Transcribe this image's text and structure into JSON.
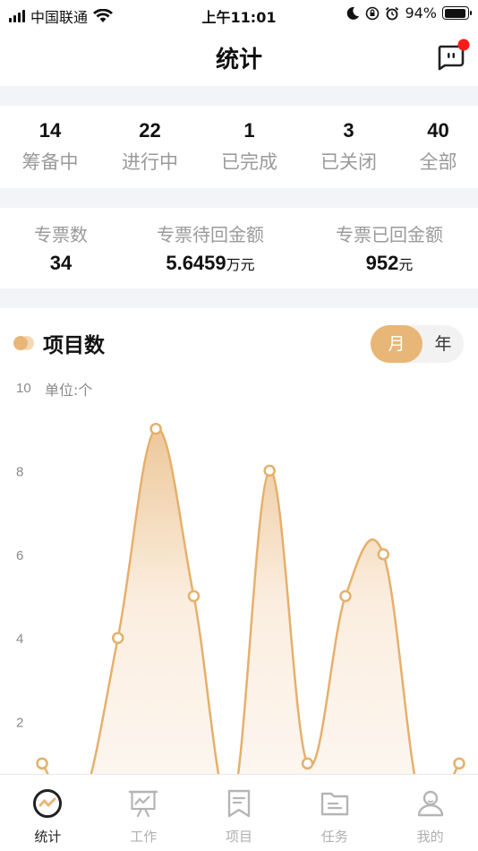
{
  "status_bar": {
    "carrier": "中国联通",
    "time": "上午11:01",
    "battery": "94%",
    "battery_level": 0.94
  },
  "nav": {
    "title": "统计",
    "message_icon": "chat-bubble-icon",
    "has_notification": true
  },
  "project_stats": [
    {
      "count": "14",
      "label": "筹备中"
    },
    {
      "count": "22",
      "label": "进行中"
    },
    {
      "count": "1",
      "label": "已完成"
    },
    {
      "count": "3",
      "label": "已关闭"
    },
    {
      "count": "40",
      "label": "全部"
    }
  ],
  "tickets": {
    "count_label": "专票数",
    "count_value": "34",
    "pending_label": "专票待回金额",
    "pending_value": "5.6459",
    "pending_unit": "万元",
    "returned_label": "专票已回金额",
    "returned_value": "952",
    "returned_unit": "元"
  },
  "chart_section": {
    "title": "项目数",
    "toggle_month": "月",
    "toggle_year": "年",
    "selected": "月",
    "unit_label": "单位:个"
  },
  "chart_data": {
    "type": "area",
    "y_ticks": [
      10,
      8,
      6,
      4,
      2
    ],
    "ylim": [
      0,
      10
    ],
    "points": [
      1,
      0,
      4,
      9,
      5,
      0,
      8,
      1,
      5,
      6,
      0,
      1
    ],
    "color": "#e5b06c",
    "grid": false
  },
  "tabbar": [
    {
      "label": "统计",
      "icon": "stats-icon",
      "active": true
    },
    {
      "label": "工作",
      "icon": "easel-chart-icon",
      "active": false
    },
    {
      "label": "项目",
      "icon": "bookmark-book-icon",
      "active": false
    },
    {
      "label": "任务",
      "icon": "folder-icon",
      "active": false
    },
    {
      "label": "我的",
      "icon": "user-icon",
      "active": false
    }
  ],
  "colors": {
    "accent": "#e8b677",
    "separator": "#f3f4f8",
    "muted_text": "#9a9a9a",
    "notification": "#ff1a1a"
  }
}
